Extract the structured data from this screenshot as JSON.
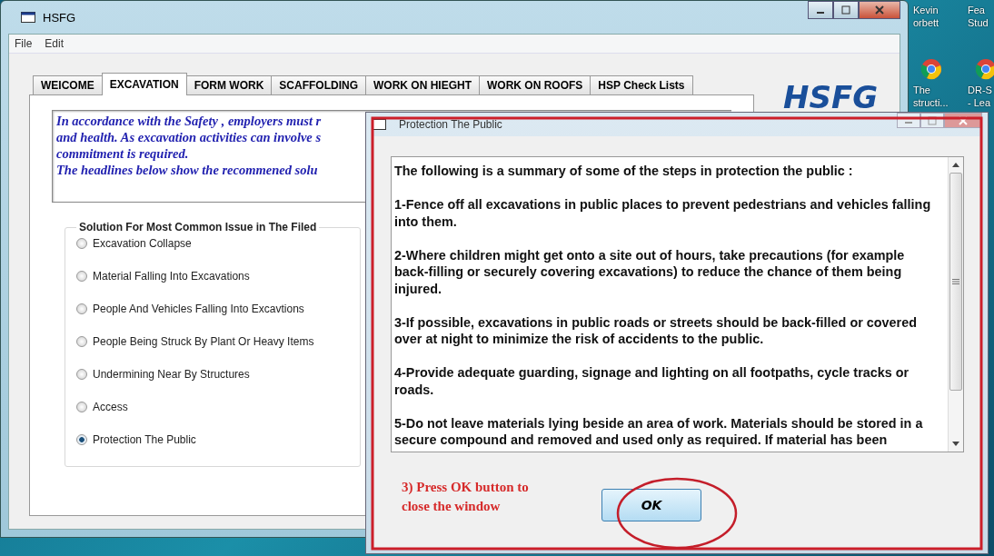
{
  "window": {
    "title": "HSFG"
  },
  "menu": [
    "File",
    "Edit"
  ],
  "tabs": [
    {
      "label": "WEICOME",
      "selected": false
    },
    {
      "label": "EXCAVATION",
      "selected": true
    },
    {
      "label": "FORM WORK",
      "selected": false
    },
    {
      "label": "SCAFFOLDING",
      "selected": false
    },
    {
      "label": "WORK ON HIEGHT",
      "selected": false
    },
    {
      "label": "WORK ON ROOFS",
      "selected": false
    },
    {
      "label": "HSP Check Lists",
      "selected": false
    }
  ],
  "logo": "HSFG",
  "intro_lines": [
    "In accordance with the Safety , employers must r",
    "and health. As excavation activities can involve s",
    "commitment is required.",
    "The headlines  below show the recommened  solu"
  ],
  "group": {
    "title": "Solution For Most Common Issue in The Filed",
    "options": [
      {
        "label": "Excavation Collapse",
        "selected": false
      },
      {
        "label": "Material Falling Into Excavations",
        "selected": false
      },
      {
        "label": "People And Vehicles Falling Into Excavtions",
        "selected": false
      },
      {
        "label": "People Being Struck By Plant Or Heavy Items",
        "selected": false
      },
      {
        "label": "Undermining Near By Structures",
        "selected": false
      },
      {
        "label": "Access",
        "selected": false
      },
      {
        "label": "Protection The Public",
        "selected": true
      }
    ]
  },
  "desktop_icons": [
    {
      "lines": [
        "Kevin",
        "orbett"
      ],
      "kind": "file"
    },
    {
      "lines": [
        "Fea",
        "Stud"
      ],
      "kind": "file"
    },
    {
      "lines": [
        "The",
        "structi..."
      ],
      "kind": "browser"
    },
    {
      "lines": [
        "DR-S",
        "- Lea"
      ],
      "kind": "browser"
    }
  ],
  "dialog": {
    "title": "Protection The Public",
    "paragraphs": [
      {
        "lines": [
          "The following is a summary of some of the steps in protection the public :"
        ]
      },
      {
        "lines": [
          "1-Fence off all excavations in public places to prevent pedestrians and vehicles falling",
          "into them."
        ]
      },
      {
        "lines": [
          "2-Where children might get onto a site out of hours, take precautions (for example",
          "back-filling or securely covering excavations) to reduce the chance of them being",
          "injured."
        ]
      },
      {
        "lines": [
          "3-If possible, excavations in public roads or streets should be back-filled or covered",
          "over at night to minimize the risk of accidents to the public."
        ]
      },
      {
        "lines": [
          "4-Provide adequate guarding, signage and lighting on all footpaths, cycle tracks or",
          "roads."
        ]
      },
      {
        "lines": [
          "5-Do not leave materials lying beside an area of work. Materials should be stored in a",
          "secure compound and removed and used only as required. If material has been"
        ]
      }
    ],
    "button": "OK"
  },
  "annotation": "3) Press OK button to close the window"
}
